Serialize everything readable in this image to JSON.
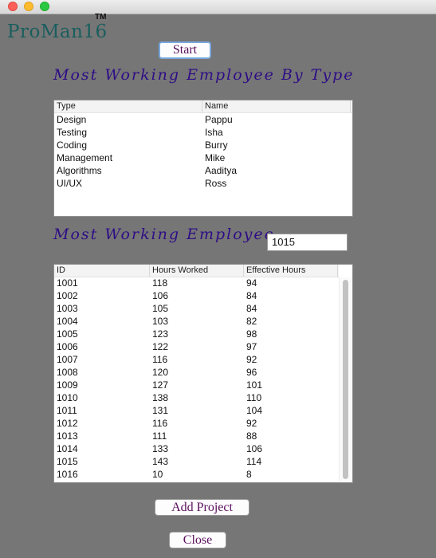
{
  "app": {
    "logo": "ProMan16",
    "trademark": "TM"
  },
  "buttons": {
    "start": "Start",
    "add_project": "Add Project",
    "close": "Close"
  },
  "type_section": {
    "heading": "Most Working Employee By Type",
    "columns": [
      "Type",
      "Name"
    ],
    "rows": [
      [
        "Design",
        "Pappu"
      ],
      [
        "Testing",
        "Isha"
      ],
      [
        "Coding",
        "Burry"
      ],
      [
        "Management",
        "Mike"
      ],
      [
        "Algorithms",
        "Aaditya"
      ],
      [
        "UI/UX",
        "Ross"
      ]
    ]
  },
  "employee_section": {
    "heading": "Most Working Employee",
    "value": "1015",
    "columns": [
      "ID",
      "Hours Worked",
      "Effective Hours"
    ],
    "rows": [
      [
        "1001",
        "118",
        "94"
      ],
      [
        "1002",
        "106",
        "84"
      ],
      [
        "1003",
        "105",
        "84"
      ],
      [
        "1004",
        "103",
        "82"
      ],
      [
        "1005",
        "123",
        "98"
      ],
      [
        "1006",
        "122",
        "97"
      ],
      [
        "1007",
        "116",
        "92"
      ],
      [
        "1008",
        "120",
        "96"
      ],
      [
        "1009",
        "127",
        "101"
      ],
      [
        "1010",
        "138",
        "110"
      ],
      [
        "1011",
        "131",
        "104"
      ],
      [
        "1012",
        "116",
        "92"
      ],
      [
        "1013",
        "111",
        "88"
      ],
      [
        "1014",
        "133",
        "106"
      ],
      [
        "1015",
        "143",
        "114"
      ],
      [
        "1016",
        "10",
        "8"
      ]
    ]
  }
}
